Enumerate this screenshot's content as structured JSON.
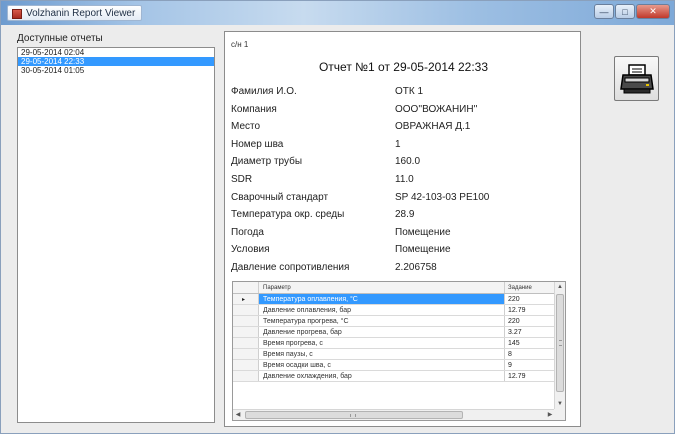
{
  "window": {
    "title": "Volzhanin Report Viewer"
  },
  "reports_list": {
    "label": "Доступные отчеты",
    "items": [
      "29-05-2014 02:04",
      "29-05-2014 22:33",
      "30-05-2014 01:05"
    ],
    "selected_index": 1
  },
  "report": {
    "page_tag": "с/н 1",
    "title": "Отчет №1 от 29-05-2014 22:33",
    "fields": [
      {
        "label": "Фамилия И.О.",
        "value": "ОТК 1"
      },
      {
        "label": "Компания",
        "value": "ООО''ВОЖАНИН''"
      },
      {
        "label": "Место",
        "value": "ОВРАЖНАЯ Д.1"
      },
      {
        "label": "Номер шва",
        "value": "1"
      },
      {
        "label": "Диаметр трубы",
        "value": "160.0"
      },
      {
        "label": "SDR",
        "value": "11.0"
      },
      {
        "label": "Сварочный стандарт",
        "value": "SP 42-103-03 PE100"
      },
      {
        "label": "Температура окр. среды",
        "value": "28.9"
      },
      {
        "label": "Погода",
        "value": "Помещение"
      },
      {
        "label": "Условия",
        "value": "Помещение"
      },
      {
        "label": "Давление сопротивления",
        "value": "2.206758"
      }
    ],
    "grid": {
      "columns": [
        "Параметр",
        "Задание"
      ],
      "current_row_marker": "▸",
      "rows": [
        {
          "param": "Температура оплавления, °С",
          "value": "220"
        },
        {
          "param": "Давление оплавления, бар",
          "value": "12.79"
        },
        {
          "param": "Температура прогрева, °С",
          "value": "220"
        },
        {
          "param": "Давление прогрева, бар",
          "value": "3.27"
        },
        {
          "param": "Время прогрева, с",
          "value": "145"
        },
        {
          "param": "Время паузы, с",
          "value": "8"
        },
        {
          "param": "Время осадки шва, с",
          "value": "9"
        },
        {
          "param": "Давление охлаждения, бар",
          "value": "12.79"
        }
      ],
      "selected_row": 0
    }
  },
  "buttons": {
    "print_icon": "printer-icon"
  },
  "colors": {
    "selection": "#3399ff",
    "titlebar": "#9dbfe3"
  }
}
